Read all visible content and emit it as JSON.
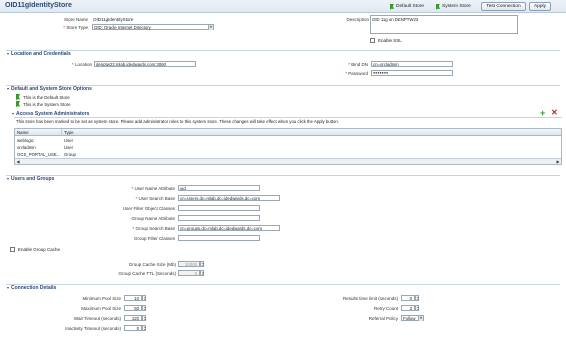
{
  "header": {
    "title": "OID11gIdentityStore",
    "default_store_label": "Default Store",
    "system_store_label": "System Store",
    "test_connection_label": "Test Connection",
    "apply_label": "Apply"
  },
  "general": {
    "store_name_label": "Store Name",
    "store_name_value": "OID11gIdentityStore",
    "store_type_label": "Store Type",
    "store_type_value": "OID: Oracle Internet Directory",
    "description_label": "Description",
    "description_value": "OID 11g on DENPTW23",
    "enable_ssl_label": "Enable SSL"
  },
  "location": {
    "section_title": "Location and Credentials",
    "location_label": "Location",
    "location_value": "denptw23.mlab.jdedwards.com:3060",
    "bind_dn_label": "Bind DN",
    "bind_dn_value": "cn=orcladmin",
    "password_label": "Password",
    "password_value": "●●●●●●●"
  },
  "store_options": {
    "section_title": "Default and System Store Options",
    "default_note": "This is the Default Store",
    "system_note": "This is the System Store"
  },
  "admins": {
    "section_title": "Access System Administrators",
    "info_text": "This store has been marked to be set as system store. Please add administrator roles to this system store. These changes will take effect when you click the Apply button.",
    "columns": [
      "Name",
      "Type"
    ],
    "rows": [
      {
        "name": "weblogic",
        "type": "User"
      },
      {
        "name": "orcladmin",
        "type": "User"
      },
      {
        "name": "OCS_PORTAL_USE...",
        "type": "Group"
      }
    ]
  },
  "users_groups": {
    "section_title": "Users and Groups",
    "user_name_attr_label": "User Name Attribute",
    "user_name_attr_value": "uid",
    "user_search_base_label": "User Search Base",
    "user_search_base_value": "cn=Users,dc=mlab,dc=jdedwards,dc=com",
    "user_filter_label": "User Filter Object Classes",
    "group_name_attr_label": "Group Name Attribute",
    "group_search_base_label": "Group Search Base",
    "group_search_base_value": "cn=groups,dc=mlab,dc=jdedwards,dc=com",
    "group_filter_label": "Group Filter Classes",
    "enable_group_cache_label": "Enable Group Cache",
    "group_cache_size_label": "Group Cache Size (Mb)",
    "group_cache_size_value": "10000",
    "group_cache_ttl_label": "Group Cache TTL (Seconds)",
    "group_cache_ttl_value": "0"
  },
  "connection": {
    "section_title": "Connection Details",
    "min_pool_label": "Minimum Pool Size",
    "min_pool_value": "10",
    "max_pool_label": "Maximum Pool Size",
    "max_pool_value": "50",
    "wait_timeout_label": "Wait Timeout (seconds)",
    "wait_timeout_value": "120",
    "inactivity_timeout_label": "Inactivity Timeout (seconds)",
    "inactivity_timeout_value": "0",
    "results_time_limit_label": "Results time limit (seconds)",
    "results_time_limit_value": "0",
    "retry_count_label": "Retry Count",
    "retry_count_value": "3",
    "referral_policy_label": "Referral Policy",
    "referral_policy_value": "Follow"
  },
  "colors": {
    "title": "#2a4a73",
    "required": "#c2271b",
    "flag": "#3a9a2a"
  }
}
